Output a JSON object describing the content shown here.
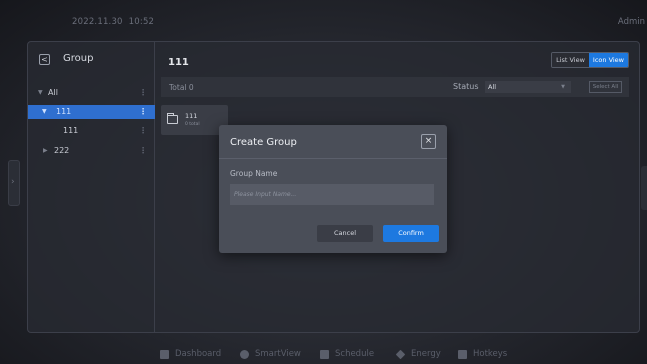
{
  "topbar": {
    "date": "2022.11.30",
    "time": "10:52",
    "user": "Admin"
  },
  "sidebar": {
    "title": "Group",
    "back_glyph": "<",
    "items": [
      {
        "label": "All",
        "caret": "▼",
        "more": "⋮",
        "selected": false
      },
      {
        "label": "111",
        "caret": "▼",
        "more": "⋮",
        "selected": true
      },
      {
        "label": "111",
        "caret": "",
        "more": "⋮",
        "selected": false
      },
      {
        "label": "222",
        "caret": "▶",
        "more": "⋮",
        "selected": false
      }
    ]
  },
  "content": {
    "title": "111",
    "view_toggle": {
      "list": "List View",
      "icon": "Icon View",
      "active": "icon"
    },
    "total_label": "Total  0",
    "status_label": "Status",
    "status_value": "All",
    "select_all": "Select All",
    "group_card": {
      "name": "111",
      "count": "0 total",
      "icon": "folder-icon"
    }
  },
  "modal": {
    "title": "Create Group",
    "close_glyph": "×",
    "field_label": "Group Name",
    "field_placeholder": "Please Input Name...",
    "field_value": "",
    "cancel_label": "Cancel",
    "confirm_label": "Confirm"
  },
  "bottom_nav": [
    {
      "label": "Dashboard",
      "icon": "dashboard-icon"
    },
    {
      "label": "SmartView",
      "icon": "smartview-icon"
    },
    {
      "label": "Schedule",
      "icon": "schedule-icon"
    },
    {
      "label": "Energy",
      "icon": "energy-icon"
    },
    {
      "label": "Hotkeys",
      "icon": "hotkeys-icon"
    }
  ],
  "colors": {
    "accent": "#1d79e0",
    "selected_row": "#2f6fcf",
    "panel": "#282a32",
    "modal": "#4a4e58"
  }
}
